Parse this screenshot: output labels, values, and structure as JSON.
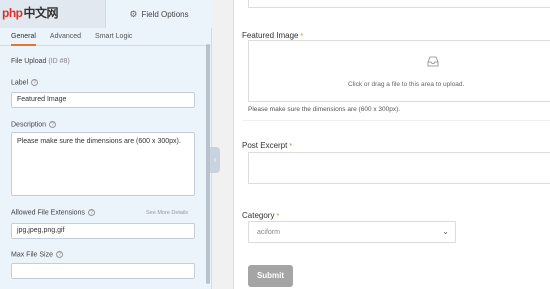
{
  "logo": {
    "latin": "php",
    "cn": "中文网"
  },
  "panel": {
    "field_options_tab": "Field Options",
    "subtabs": [
      "General",
      "Advanced",
      "Smart Logic"
    ],
    "field_title": "File Upload",
    "field_id": "(ID #8)",
    "label_label": "Label",
    "label_value": "Featured Image",
    "description_label": "Description",
    "description_value": "Please make sure the dimensions are (600 x 300px).",
    "extensions_label": "Allowed File Extensions",
    "see_more": "See More Details",
    "extensions_value": "jpg,jpeg,png,gif",
    "max_size_label": "Max File Size",
    "max_size_value": ""
  },
  "preview": {
    "featured_label": "Featured Image",
    "required_mark": "*",
    "upload_text": "Click or drag a file to this area to upload.",
    "upload_desc": "Please make sure the dimensions are (600 x 300px).",
    "excerpt_label": "Post Excerpt",
    "category_label": "Category",
    "category_value": "aciform",
    "submit_label": "Submit"
  },
  "colors": {
    "accent": "#e27730",
    "panel_bg": "#ebf3fb",
    "submit_bg": "#a5a5a5"
  }
}
